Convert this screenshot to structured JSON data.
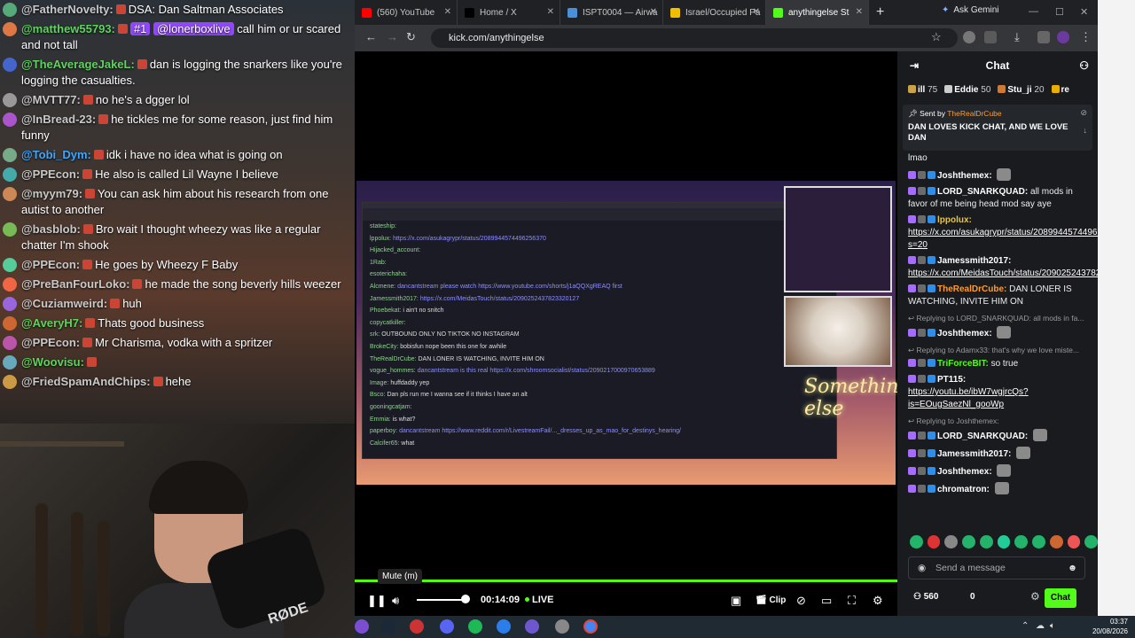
{
  "left_chat": [
    {
      "user": "@FatherNovelty:",
      "text": "DSA: Dan Saltman Associates",
      "color": "#c9c9c9"
    },
    {
      "user": "@matthew55793:",
      "text": "call him or ur scared and not tall",
      "mention": "@lonerboxlive",
      "badge": "#1",
      "color": "#5fd35f"
    },
    {
      "user": "@TheAverageJakeL:",
      "text": "dan is logging the snarkers like you're logging the casualties.",
      "color": "#5fd35f"
    },
    {
      "user": "@MVTT77:",
      "text": "no he's a dgger lol",
      "color": "#c9c9c9"
    },
    {
      "user": "@InBread-23:",
      "text": "he tickles me for some reason, just find him funny",
      "color": "#c9c9c9"
    },
    {
      "user": "@Tobi_Dym:",
      "text": "idk i have no idea what is going on",
      "color": "#3ea6ff"
    },
    {
      "user": "@PPEcon:",
      "text": "He also is called Lil Wayne I believe",
      "color": "#c9c9c9"
    },
    {
      "user": "@myym79:",
      "text": "You can ask him about his research from one autist to another",
      "color": "#c9c9c9"
    },
    {
      "user": "@basblob:",
      "text": "Bro wait I thought wheezy was like a regular chatter I'm shook",
      "color": "#c9c9c9"
    },
    {
      "user": "@PPEcon:",
      "text": "He goes by Wheezy F Baby",
      "color": "#c9c9c9"
    },
    {
      "user": "@PreBanFourLoko:",
      "text": "he made the song beverly hills weezer",
      "color": "#c9c9c9"
    },
    {
      "user": "@Cuziamweird:",
      "text": "huh",
      "color": "#c9c9c9"
    },
    {
      "user": "@AveryH7:",
      "text": "Thats good business",
      "color": "#5fd35f"
    },
    {
      "user": "@PPEcon:",
      "text": "Mr Charisma, vodka with a spritzer",
      "color": "#c9c9c9"
    },
    {
      "user": "@Woovisu:",
      "text": "",
      "color": "#5fd35f"
    },
    {
      "user": "@FriedSpamAndChips:",
      "text": "hehe",
      "color": "#c9c9c9"
    }
  ],
  "cam": {
    "brand": "RØDE"
  },
  "browser": {
    "tabs": [
      {
        "label": "(560) YouTube",
        "color": "#ff0000",
        "active": false
      },
      {
        "label": "Home / X",
        "color": "#000000",
        "active": false
      },
      {
        "label": "ISPT0004 — Airwa",
        "color": "#4a90d9",
        "active": false
      },
      {
        "label": "Israel/Occupied Pa",
        "color": "#f0c000",
        "active": false
      },
      {
        "label": "anythingelse St",
        "color": "#53fc18",
        "active": true
      }
    ],
    "gemini": "Ask Gemini",
    "url": "kick.com/anythingelse"
  },
  "video": {
    "tooltip": "Mute (m)",
    "time": "00:14:09",
    "live": "LIVE",
    "clip": "Clip",
    "neon": "Something else",
    "progress_fraction": 1.0,
    "volume_fraction": 0.9,
    "inner_chat": [
      {
        "u": "stateship:",
        "t": ""
      },
      {
        "u": "lppolux:",
        "t": "https://x.com/asukagrypr/status/2089944574496256370",
        "link": true
      },
      {
        "u": "Hijacked_account:",
        "t": ""
      },
      {
        "u": "1Rab:",
        "t": ""
      },
      {
        "u": "esoterichaha:",
        "t": ""
      },
      {
        "u": "Alcmene:",
        "t": "dancantstream please watch  https://www.youtube.com/shorts/j1aQQXgREAQ first",
        "link": true
      },
      {
        "u": "Jamessmith2017:",
        "t": "https://x.com/MeidasTouch/status/2090252437823320127",
        "link": true
      },
      {
        "u": "Phoebekat:",
        "t": "i ain't no snitch"
      },
      {
        "u": "copycatkiller:",
        "t": ""
      },
      {
        "u": "srk:",
        "t": "OUTBOUND ONLY   NO TIKTOK   NO INSTAGRAM"
      },
      {
        "u": "BrokeCity:",
        "t": "bobisfun nope been this one for awhile"
      },
      {
        "u": "TheRealDrCube:",
        "t": "DAN LONER IS WATCHING, INVITE HIM ON"
      },
      {
        "u": "vogue_hommes:",
        "t": "dancantstream is this real https://x.com/shroomsocialist/status/2090217000970653889",
        "link": true
      },
      {
        "u": "Image:",
        "t": "huffdaddy yep"
      },
      {
        "u": "Bsco:",
        "t": "Dan pls run me I wanna see if it thinks I have an alt"
      },
      {
        "u": "gooningcatjam:",
        "t": ""
      },
      {
        "u": "Emmia:",
        "t": "is what?"
      },
      {
        "u": "paperboy:",
        "t": "dancantstream https://www.reddit.com/r/LivestreamFail/..._dresses_up_as_mao_for_destinys_hearing/",
        "link": true
      },
      {
        "u": "Calcifer65:",
        "t": "what"
      }
    ]
  },
  "chat": {
    "title": "Chat",
    "leaders": [
      {
        "name": "ill",
        "count": "75"
      },
      {
        "name": "Eddie",
        "count": "50"
      },
      {
        "name": "Stu_ji",
        "count": "20"
      },
      {
        "name": "re",
        "count": ""
      }
    ],
    "pinned": {
      "sent_by": "Sent by",
      "user": "TheRealDrCube",
      "message": "DAN LOVES KICK CHAT, AND WE LOVE DAN"
    },
    "messages": [
      {
        "type": "text",
        "user": "",
        "color": "#ffffff",
        "text": "lmao"
      },
      {
        "type": "text",
        "user": "Joshthemex:",
        "color": "#ffffff",
        "text": "",
        "emote": true
      },
      {
        "type": "text",
        "user": "LORD_SNARKQUAD:",
        "color": "#ffffff",
        "text": "all mods in favor of me being head mod say aye"
      },
      {
        "type": "link",
        "user": "lppolux:",
        "color": "#e7c44a",
        "text": "https://x.com/asukagrypr/status/2089944574496256370?s=20"
      },
      {
        "type": "link",
        "user": "Jamessmith2017:",
        "color": "#ffffff",
        "text": "https://x.com/MeidasTouch/status/2090252437823320127"
      },
      {
        "type": "text",
        "user": "TheRealDrCube:",
        "color": "#ff9b2f",
        "text": "DAN LONER IS WATCHING, INVITE HIM ON"
      },
      {
        "type": "reply",
        "text": "Replying to LORD_SNARKQUAD: all mods in fa..."
      },
      {
        "type": "text",
        "user": "Joshthemex:",
        "color": "#ffffff",
        "text": "",
        "emote": true
      },
      {
        "type": "reply",
        "text": "Replying to Adamx33: that's why we love miste..."
      },
      {
        "type": "text",
        "user": "TriForceBIT:",
        "color": "#53fc18",
        "text": "so true"
      },
      {
        "type": "link",
        "user": "PT115:",
        "color": "#ffffff",
        "text": "https://youtu.be/ibW7wgjrcQs?is=EOugSaezNl_gooWp"
      },
      {
        "type": "reply",
        "text": "Replying to Joshthemex:"
      },
      {
        "type": "text",
        "user": "LORD_SNARKQUAD:",
        "color": "#ffffff",
        "text": "",
        "emote": true
      },
      {
        "type": "text",
        "user": "Jamessmith2017:",
        "color": "#ffffff",
        "text": "",
        "emote": true
      },
      {
        "type": "text",
        "user": "Joshthemex:",
        "color": "#ffffff",
        "text": "",
        "emote": true
      },
      {
        "type": "text",
        "user": "chromatron:",
        "color": "#ffffff",
        "text": "",
        "emote": true
      }
    ],
    "placeholder": "Send a message",
    "viewers": "560",
    "zero": "0",
    "chat_button": "Chat"
  },
  "taskbar": {
    "time": "03:37",
    "date": "20/08/2026"
  }
}
